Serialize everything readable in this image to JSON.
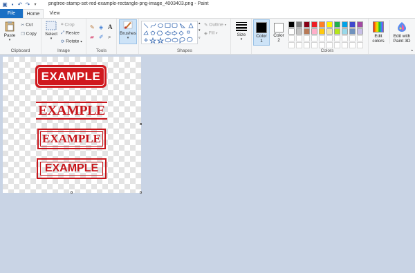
{
  "window": {
    "title": "pngtree-stamp-set-red-example-rectangle-png-image_4003403.png - Paint"
  },
  "tabs": {
    "file": "File",
    "home": "Home",
    "view": "View"
  },
  "ribbon": {
    "clipboard": {
      "label": "Clipboard",
      "paste": "Paste",
      "cut": "Cut",
      "copy": "Copy"
    },
    "image": {
      "label": "Image",
      "select": "Select",
      "crop": "Crop",
      "resize": "Resize",
      "rotate": "Rotate"
    },
    "tools": {
      "label": "Tools"
    },
    "brushes": "Brushes",
    "shapes": {
      "label": "Shapes",
      "outline": "Outline",
      "fill": "Fill"
    },
    "size": "Size",
    "color1": {
      "line1": "Color",
      "line2": "1"
    },
    "color2": {
      "line1": "Color",
      "line2": "2"
    },
    "colors": {
      "label": "Colors"
    },
    "edit_colors": {
      "line1": "Edit",
      "line2": "colors"
    },
    "paint3d": {
      "line1": "Edit with",
      "line2": "Paint 3D"
    }
  },
  "palette_row1": [
    "#000000",
    "#7f7f7f",
    "#880015",
    "#ed1c24",
    "#ff7f27",
    "#fff200",
    "#22b14c",
    "#00a2e8",
    "#3f48cc",
    "#a349a4"
  ],
  "palette_row2": [
    "#ffffff",
    "#c3c3c3",
    "#b97a57",
    "#ffaec9",
    "#ffc90e",
    "#efe4b0",
    "#b5e61d",
    "#99d9ea",
    "#7092be",
    "#c8bfe7"
  ],
  "canvas": {
    "stamps": [
      "EXAMPLE",
      "EXAMPLE",
      "EXAMPLE",
      "EXAMPLE"
    ]
  }
}
